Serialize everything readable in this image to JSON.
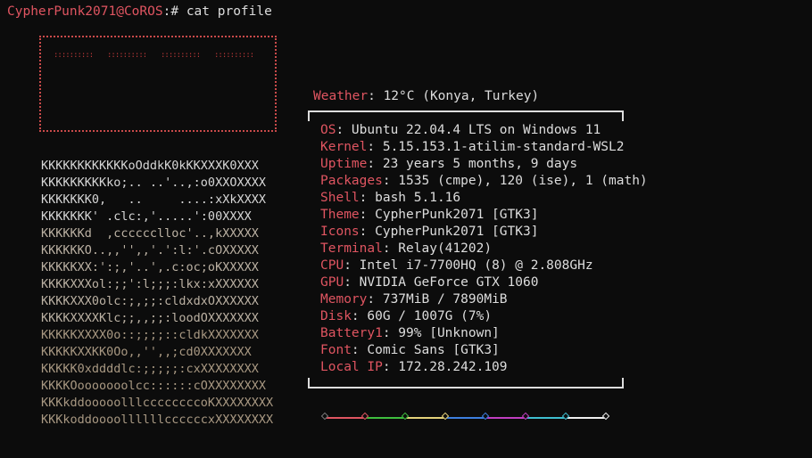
{
  "terminal": {
    "prompt_user": "CypherPunk2071@CoROS",
    "prompt_suffix": ":# ",
    "command": "cat profile"
  },
  "banner_text": "DRUM",
  "ascii_art": [
    "KKKKKKKKKKKKoOddkK0kKKXXXK0XXX",
    "KKKKKKKKKko;.. ..'..,:o0XXOXXXX",
    "KKKKKKK0,   ..     ....:xXkXXXX",
    "KKKKKKK' .clc:,'.....':00XXXX",
    "KKKKKKd  ,cccccclloc'..,kXXXXX",
    "KKKKKKO..,,'',,'.':l:'.cOXXXXX",
    "KKKKKXX:':;,'..',.c:oc;oKXXXXX",
    "KKKKXXXol:;;':l;;;:lkx:xXXXXXX",
    "KKKKXXX0olc:;,;;:cldxdxOXXXXXX",
    "KKKKXXXXKlc;;,,;;:loodOXXXXXXX",
    "KKKKKXXXX0o::;;;;::cldkXXXXXXX",
    "KKKKKXXKK0Oo,,'',,;cd0XXXXXXX",
    "KKKKK0xddddlc:;;;;;:cxXXXXXXXX",
    "KKKKOooooooolcc::::::cOXXXXXXXX",
    "KKKkddooooolllccccccccoKXXXXXXXX",
    "KKKkoddoooollllllccccccxXXXXXXXX"
  ],
  "weather": {
    "label": "Weather",
    "value": ": 12°C (Konya, Turkey)"
  },
  "info": [
    {
      "key": "OS",
      "value": ": Ubuntu 22.04.4 LTS on Windows 11"
    },
    {
      "key": "Kernel",
      "value": ": 5.15.153.1-atilim-standard-WSL2"
    },
    {
      "key": "Uptime",
      "value": ": 23 years 5 months, 9 days"
    },
    {
      "key": "Packages",
      "value": ": 1535 (cmpe), 120 (ise), 1 (math)"
    },
    {
      "key": "Shell",
      "value": ": bash 5.1.16"
    },
    {
      "key": "Theme",
      "value": ": CypherPunk2071 [GTK3]"
    },
    {
      "key": "Icons",
      "value": ": CypherPunk2071 [GTK3]"
    },
    {
      "key": "Terminal",
      "value": ": Relay(41202)"
    },
    {
      "key": "CPU",
      "value": ": Intel i7-7700HQ (8) @ 2.808GHz"
    },
    {
      "key": "GPU",
      "value": ": NVIDIA GeForce GTX 1060"
    },
    {
      "key": "Memory",
      "value": ": 737MiB / 7890MiB"
    },
    {
      "key": "Disk",
      "value": ": 60G / 1007G (7%)"
    },
    {
      "key": "Battery1",
      "value": ": 99% [Unknown]"
    },
    {
      "key": "Font",
      "value": ": Comic Sans [GTK3]"
    },
    {
      "key": "Local IP",
      "value": ": 172.28.242.109"
    }
  ],
  "palette_colors": [
    "#7a7a7a",
    "#e05561",
    "#3fbf3f",
    "#e5d27a",
    "#3d7fe0",
    "#c13fc1",
    "#3fbfd0",
    "#eeeeee"
  ]
}
